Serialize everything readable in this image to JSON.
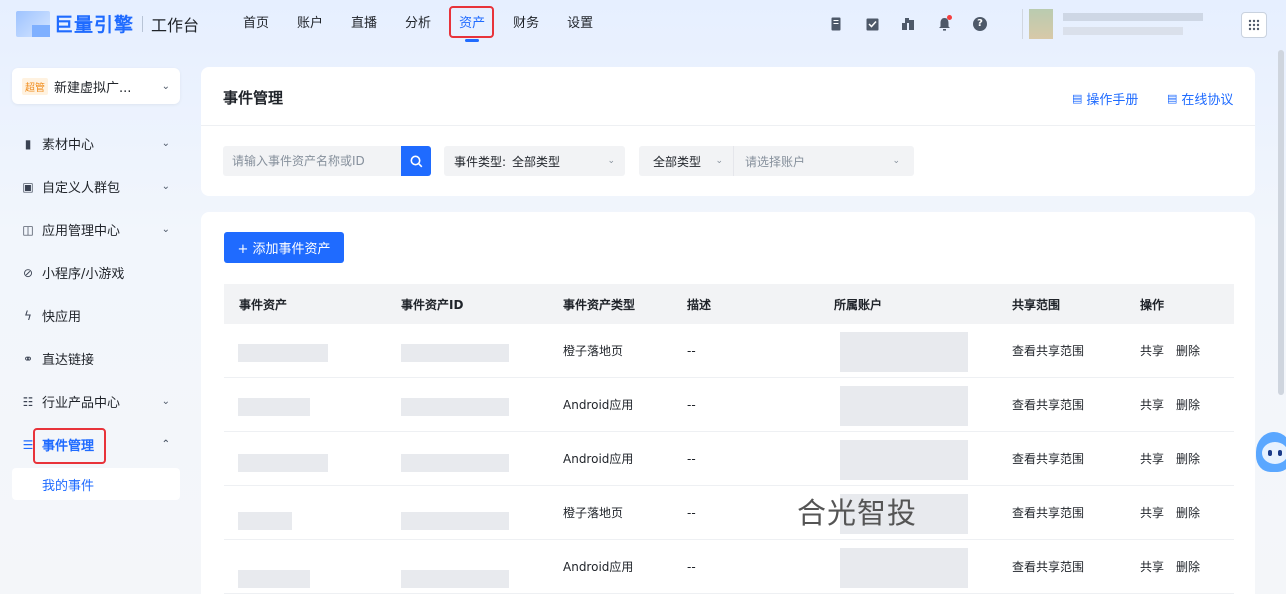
{
  "app": {
    "brand": "巨量引擎",
    "subtitle": "工作台"
  },
  "nav": [
    {
      "label": "首页"
    },
    {
      "label": "账户"
    },
    {
      "label": "直播"
    },
    {
      "label": "分析"
    },
    {
      "label": "资产",
      "active": true
    },
    {
      "label": "财务"
    },
    {
      "label": "设置"
    }
  ],
  "header_icons": [
    "document-icon",
    "clipboard-icon",
    "gift-icon",
    "bell-icon",
    "help-icon"
  ],
  "account_selector": {
    "badge": "超管",
    "name": "新建虚拟广..."
  },
  "sidebar": {
    "items": [
      {
        "label": "素材中心",
        "icon": "video-icon",
        "has_children": true
      },
      {
        "label": "自定义人群包",
        "icon": "user-card-icon",
        "has_children": true
      },
      {
        "label": "应用管理中心",
        "icon": "app-icon",
        "has_children": true
      },
      {
        "label": "小程序/小游戏",
        "icon": "miniprogram-icon",
        "has_children": false
      },
      {
        "label": "快应用",
        "icon": "lightning-icon",
        "has_children": false
      },
      {
        "label": "直达链接",
        "icon": "link-icon",
        "has_children": false
      },
      {
        "label": "行业产品中心",
        "icon": "grid-icon",
        "has_children": true
      },
      {
        "label": "事件管理",
        "icon": "event-icon",
        "has_children": true,
        "open": true
      }
    ],
    "sub_item": "我的事件"
  },
  "page": {
    "title": "事件管理",
    "manual_link": "操作手册",
    "agreement_link": "在线协议"
  },
  "filters": {
    "search_placeholder": "请输入事件资产名称或ID",
    "event_type_label": "事件类型:",
    "event_type_value": "全部类型",
    "type_value": "全部类型",
    "account_placeholder": "请选择账户"
  },
  "actions": {
    "add_label": "+ 添加事件资产"
  },
  "table": {
    "columns": [
      "事件资产",
      "事件资产ID",
      "事件资产类型",
      "描述",
      "所属账户",
      "共享范围",
      "操作"
    ],
    "rows": [
      {
        "type": "橙子落地页",
        "desc": "--",
        "scope": "查看共享范围",
        "share": "共享",
        "delete": "删除"
      },
      {
        "type": "Android应用",
        "desc": "--",
        "scope": "查看共享范围",
        "share": "共享",
        "delete": "删除"
      },
      {
        "type": "Android应用",
        "desc": "--",
        "scope": "查看共享范围",
        "share": "共享",
        "delete": "删除"
      },
      {
        "type": "橙子落地页",
        "desc": "--",
        "scope": "查看共享范围",
        "share": "共享",
        "delete": "删除"
      },
      {
        "type": "Android应用",
        "desc": "--",
        "scope": "查看共享范围",
        "share": "共享",
        "delete": "删除"
      }
    ]
  },
  "overlay_text": "合光智投",
  "colors": {
    "accent": "#1f6bff",
    "highlight": "#e8333a"
  }
}
